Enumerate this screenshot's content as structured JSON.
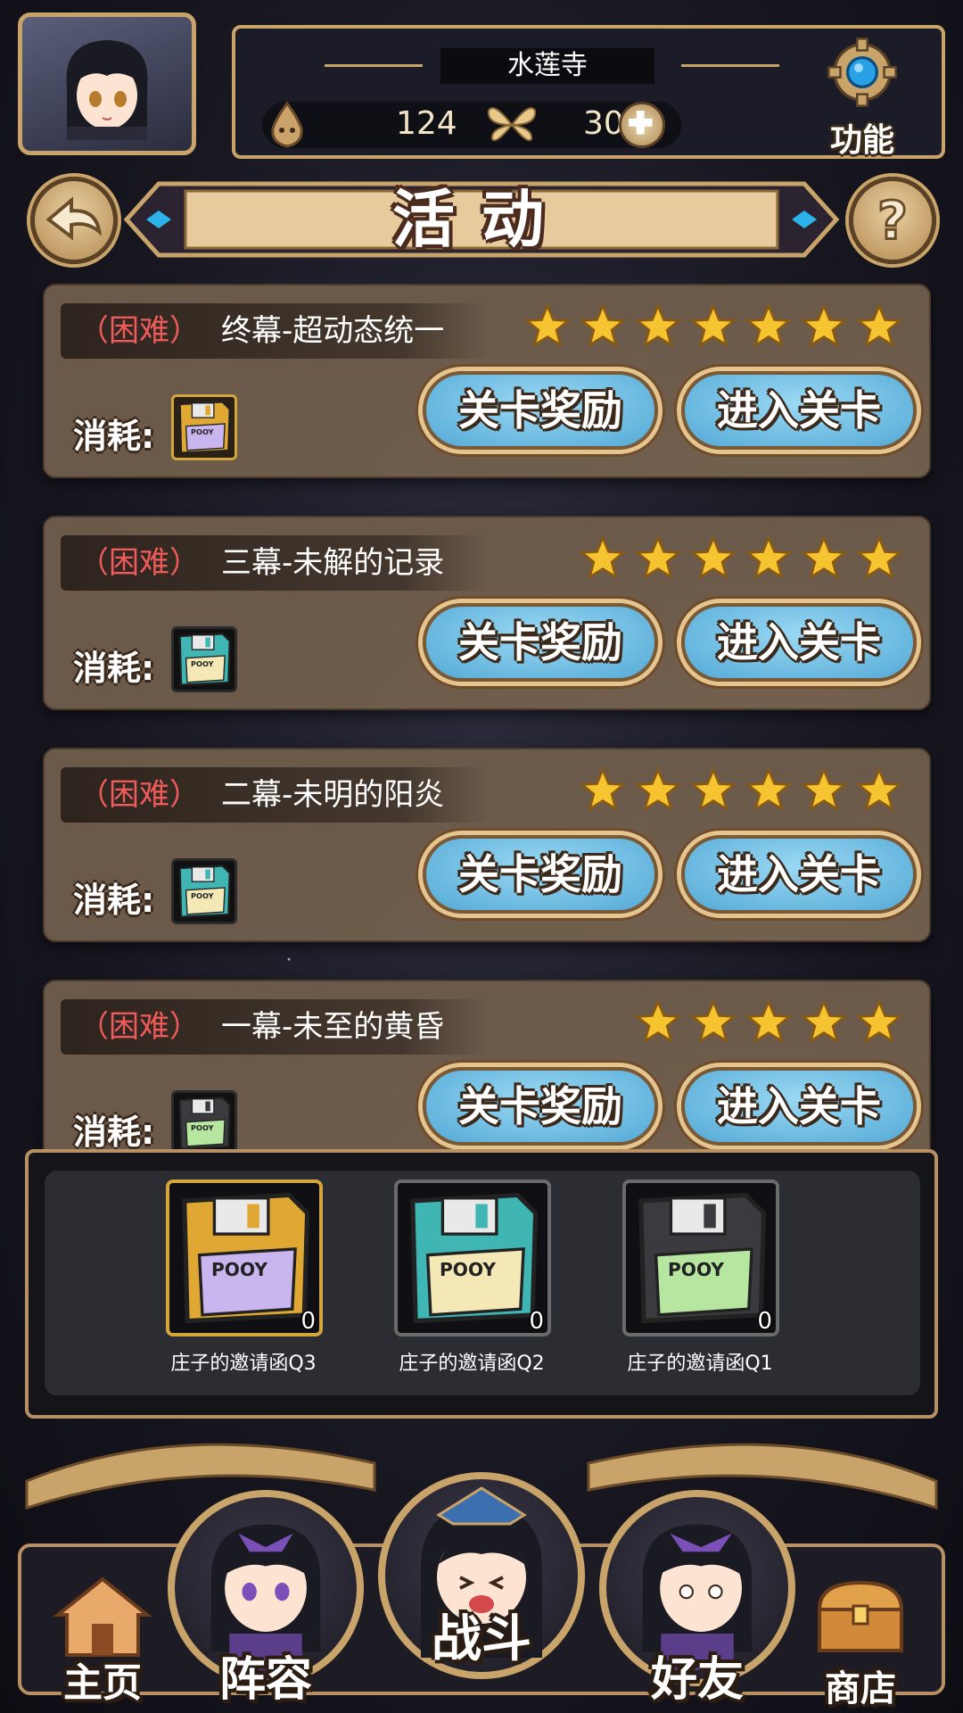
{
  "player": {
    "name": "水莲寺",
    "stamina": "124",
    "currency": "300",
    "function_label": "功能"
  },
  "page": {
    "title": "活动"
  },
  "stages": [
    {
      "difficulty": "（困难）",
      "name": "终幕-超动态统一",
      "stars": 7,
      "cost_label": "消耗:",
      "cost_item": "gold-disk",
      "reward_button": "关卡奖励",
      "enter_button": "进入关卡"
    },
    {
      "difficulty": "（困难）",
      "name": "三幕-未解的记录",
      "stars": 6,
      "cost_label": "消耗:",
      "cost_item": "teal-disk",
      "reward_button": "关卡奖励",
      "enter_button": "进入关卡"
    },
    {
      "difficulty": "（困难）",
      "name": "二幕-未明的阳炎",
      "stars": 6,
      "cost_label": "消耗:",
      "cost_item": "teal-disk",
      "reward_button": "关卡奖励",
      "enter_button": "进入关卡"
    },
    {
      "difficulty": "（困难）",
      "name": "一幕-未至的黄昏",
      "stars": 5,
      "cost_label": "消耗:",
      "cost_item": "black-disk",
      "reward_button": "关卡奖励",
      "enter_button": "进入关卡"
    }
  ],
  "inventory": [
    {
      "name": "庄子的邀请函Q3",
      "count": "0",
      "color": "#e0a832",
      "label_color": "#c9b6ef"
    },
    {
      "name": "庄子的邀请函Q2",
      "count": "0",
      "color": "#3fb6b4",
      "label_color": "#f3e8b6"
    },
    {
      "name": "庄子的邀请函Q1",
      "count": "0",
      "color": "#3b3b3f",
      "label_color": "#b6e6a0"
    }
  ],
  "disk_label": "POOY",
  "nav": {
    "home": "主页",
    "team": "阵容",
    "battle": "战斗",
    "friends": "好友",
    "shop": "商店"
  }
}
